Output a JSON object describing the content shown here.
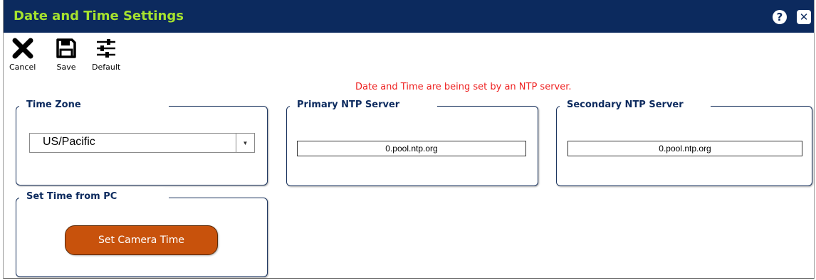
{
  "window": {
    "title": "Date and Time Settings",
    "help_glyph": "?",
    "close_glyph": "✕"
  },
  "toolbar": {
    "cancel": {
      "label": "Cancel",
      "icon": "close-x-icon"
    },
    "save": {
      "label": "Save",
      "icon": "floppy-disk-icon"
    },
    "default": {
      "label": "Default",
      "icon": "sliders-icon"
    }
  },
  "notice": "Date and Time are being set by an NTP server.",
  "time_zone": {
    "title": "Time Zone",
    "selected": "US/Pacific"
  },
  "primary_ntp": {
    "title": "Primary NTP Server",
    "value": "0.pool.ntp.org"
  },
  "secondary_ntp": {
    "title": "Secondary NTP Server",
    "value": "0.pool.ntp.org"
  },
  "set_time": {
    "title": "Set Time from PC",
    "button_label": "Set Camera Time"
  },
  "colors": {
    "titlebar_bg": "#0c2a5e",
    "title_text": "#a6e22e",
    "notice_text": "#ee2222",
    "button_bg": "#c8520c"
  }
}
